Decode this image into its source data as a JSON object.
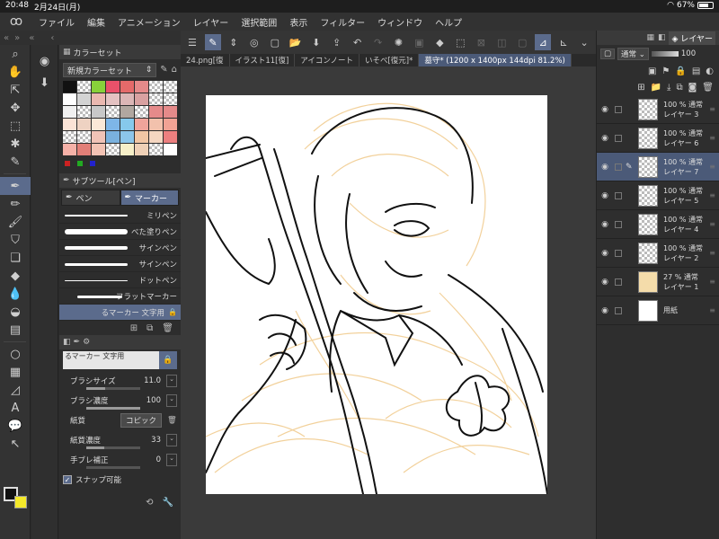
{
  "status_bar": {
    "time": "20:48",
    "date": "2月24日(月)",
    "battery": "67%"
  },
  "menu": {
    "items": [
      "ファイル",
      "編集",
      "アニメーション",
      "レイヤー",
      "選択範囲",
      "表示",
      "フィルター",
      "ウィンドウ",
      "ヘルプ"
    ]
  },
  "color_set": {
    "panel_title": "カラーセット",
    "set_name": "新規カラーセット",
    "swatches": [
      "#111111",
      "checker",
      "#88d13a",
      "#e9516a",
      "#e46a6a",
      "#e58a8a",
      "checker",
      "checker",
      "#ffffff",
      "#d3d3d3",
      "#eab8b0",
      "#e4c2c2",
      "#dcb6b6",
      "#d9a1a1",
      "checker",
      "checker",
      "#f0f0f0",
      "checker",
      "#c8c8c8",
      "checker",
      "#b1a7a0",
      "checker",
      "#e58a8a",
      "#e58a8a",
      "#fbe3d6",
      "#eed2c2",
      "#fbe8d7",
      "#7eb6e8",
      "#86c9ec",
      "#f0a49b",
      "#f2c1ac",
      "#f1a294",
      "checker",
      "checker",
      "#f1c3b7",
      "#7ab1de",
      "#8cc6ea",
      "#f1c6a4",
      "#f5d6c1",
      "#ec7f7f",
      "#f5b1a8",
      "#e27f78",
      "#f3c3b4",
      "checker",
      "#f6efc8",
      "#eed0b6",
      "checker",
      "#ffffff"
    ]
  },
  "subtool": {
    "panel_title": "サブツール[ペン]",
    "tabs": [
      "ペン",
      "マーカー"
    ],
    "brushes": [
      "ミリペン",
      "べた塗りペン",
      "サインペン",
      "サインペン",
      "ドットペン",
      "フラットマーカー",
      "るマーカー 文字用"
    ]
  },
  "tool_property": {
    "preview_label": "るマーカー 文字用",
    "brush_size_label": "ブラシサイズ",
    "brush_size": "11.0",
    "brush_density_label": "ブラシ濃度",
    "brush_density": "100",
    "paper_label": "紙質",
    "paper_value": "コピック",
    "paper_density_label": "紙質濃度",
    "paper_density": "33",
    "stabilization_label": "手ブレ補正",
    "stabilization": "0",
    "snap_label": "スナップ可能"
  },
  "document_tabs": [
    "24.png[復",
    "イラスト11[復]",
    "アイコンノート",
    "いそべ[復元]*",
    "墓守* (1200 x 1400px 144dpi 81.2%)"
  ],
  "layers": {
    "tab_label": "レイヤー",
    "blend_mode": "通常",
    "opacity": "100",
    "items": [
      {
        "opacity_mode": "100 % 通常",
        "name": "レイヤー 3",
        "active": false,
        "thumb": "checker"
      },
      {
        "opacity_mode": "100 % 通常",
        "name": "レイヤー 6",
        "active": false,
        "thumb": "checker"
      },
      {
        "opacity_mode": "100 % 通常",
        "name": "レイヤー 7",
        "active": true,
        "thumb": "checker"
      },
      {
        "opacity_mode": "100 % 通常",
        "name": "レイヤー 5",
        "active": false,
        "thumb": "checker"
      },
      {
        "opacity_mode": "100 % 通常",
        "name": "レイヤー 4",
        "active": false,
        "thumb": "checker"
      },
      {
        "opacity_mode": "100 % 通常",
        "name": "レイヤー 2",
        "active": false,
        "thumb": "checker"
      },
      {
        "opacity_mode": "27 % 通常",
        "name": "レイヤー 1",
        "active": false,
        "thumb": "sketch"
      },
      {
        "opacity_mode": "",
        "name": "用紙",
        "active": false,
        "thumb": "paper"
      }
    ]
  },
  "colors": {
    "accent": "#5b6b8c",
    "main_color": "#111111",
    "sub_color": "#f4e92a",
    "sketch_line": "#f0c98a"
  }
}
